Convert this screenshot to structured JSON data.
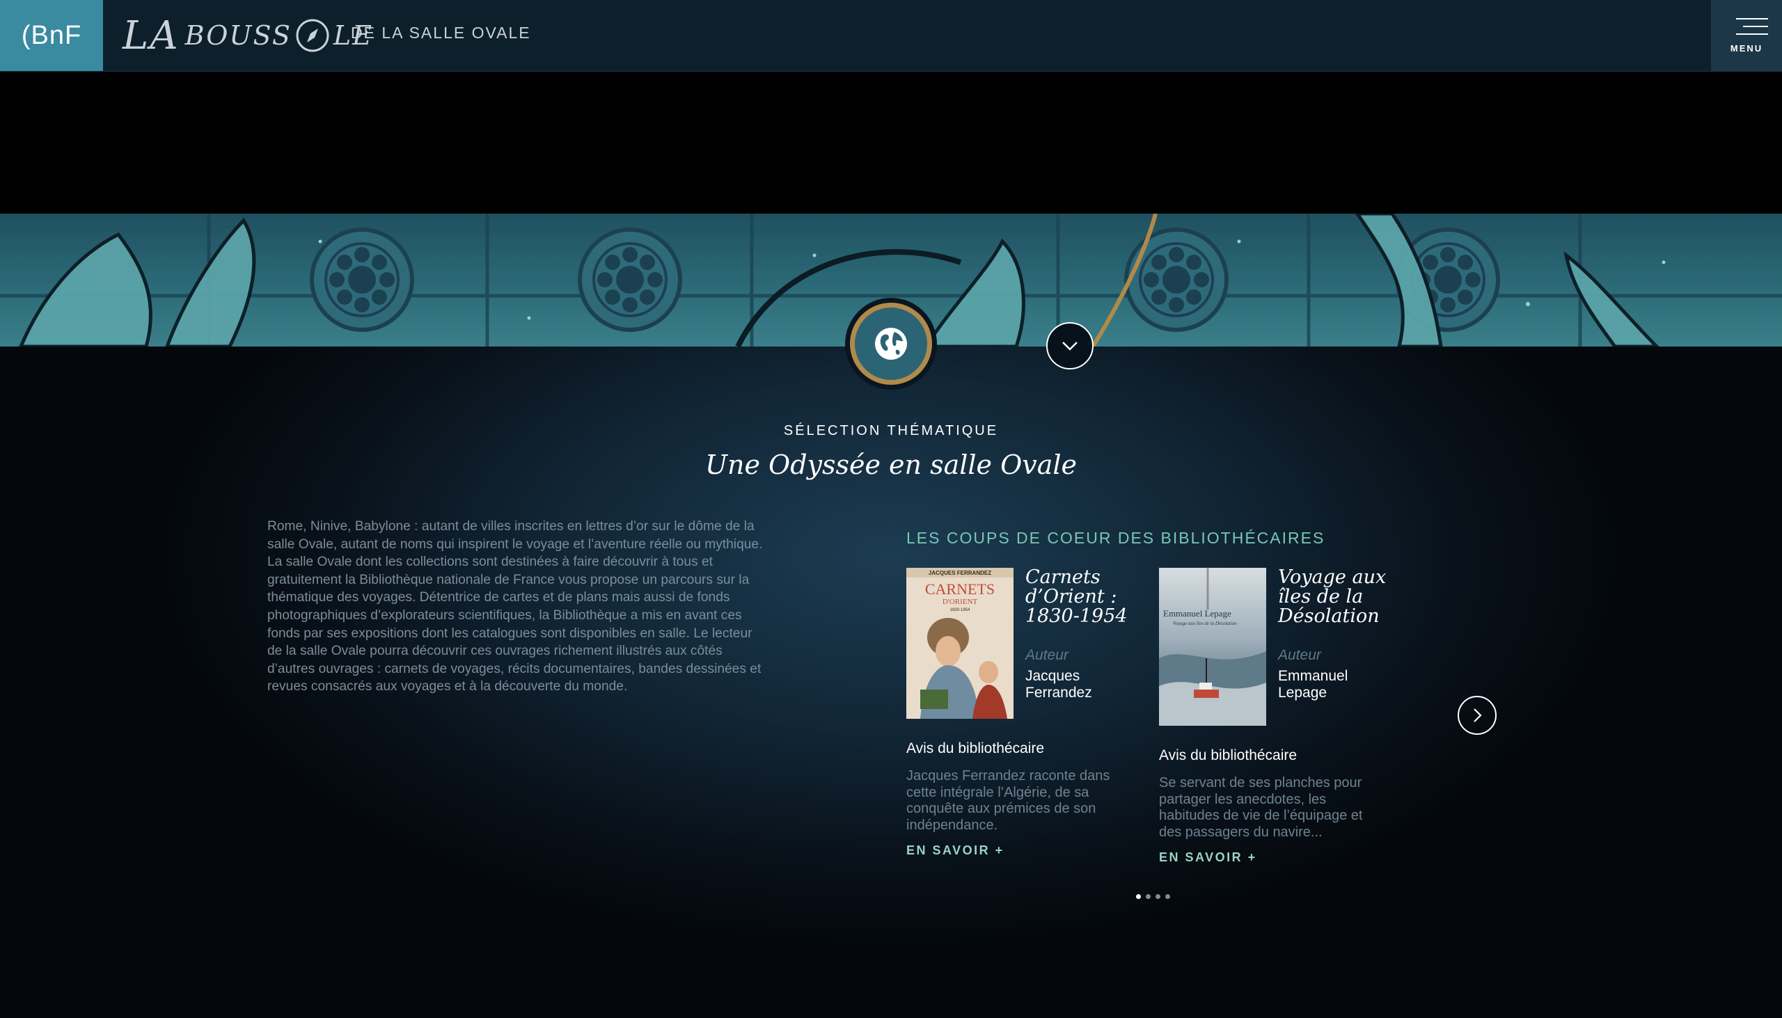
{
  "header": {
    "bnf_logo": "(BnF",
    "site_logo_prefix": "LA",
    "site_logo_main_a": "BOUSS",
    "site_logo_main_b": "LE",
    "site_subtitle": "DE LA SALLE OVALE",
    "menu_label": "MENU"
  },
  "section": {
    "eyebrow": "SÉLECTION THÉMATIQUE",
    "title": "Une Odyssée en salle Ovale",
    "intro": "Rome, Ninive, Babylone : autant de villes inscrites en lettres d’or sur le dôme de la salle Ovale, autant de noms qui inspirent le voyage et l’aventure réelle ou mythique. La salle Ovale dont les collections sont destinées à faire découvrir à tous et gratuitement la Bibliothèque nationale de France vous propose un parcours sur la thématique des voyages. Détentrice de cartes et de plans mais aussi de fonds photographiques d’explorateurs scientifiques, la Bibliothèque a mis en avant ces fonds par ses expositions dont les catalogues sont disponibles en salle. Le lecteur de la salle Ovale pourra découvrir ces ouvrages richement illustrés aux côtés d’autres ouvrages : carnets de voyages, récits documentaires, bandes dessinées et revues consacrés aux voyages et à la découverte du monde."
  },
  "picks": {
    "heading": "LES COUPS DE COEUR DES BIBLIOTHÉCAIRES",
    "cards": [
      {
        "title": "Carnets d’Orient : 1830-1954",
        "author_label": "Auteur",
        "author": "Jacques Ferrandez",
        "avis_label": "Avis du bibliothécaire",
        "avis": "Jacques Ferrandez raconte dans cette intégrale l’Algérie, de sa conquête aux prémices de son indépendance.",
        "more": "EN SAVOIR +",
        "cover_top": "JACQUES FERRANDEZ",
        "cover_main": "CARNETS",
        "cover_sub": "D'ORIENT",
        "cover_years": "1830-1954"
      },
      {
        "title": "Voyage aux îles de la Désolation",
        "author_label": "Auteur",
        "author": "Emmanuel Lepage",
        "avis_label": "Avis du bibliothécaire",
        "avis": "Se servant de ses planches pour partager les anecdotes, les habitudes de vie de l’équipage et des passagers du navire...",
        "more": "EN SAVOIR +",
        "cover_top": "Emmanuel Lepage",
        "cover_main": "Voyage aux îles de la Désolation"
      }
    ],
    "pagination": {
      "total": 4,
      "current": 1
    }
  },
  "colors": {
    "header_bg": "#0e1f2c",
    "bnf_teal": "#3a8aa0",
    "accent_mint": "#79c7b5",
    "badge_gold": "#b08a4a"
  },
  "icons": {
    "theme": "globe-icon",
    "scroll": "chevron-down-icon",
    "next": "chevron-right-icon",
    "menu": "hamburger-icon"
  }
}
